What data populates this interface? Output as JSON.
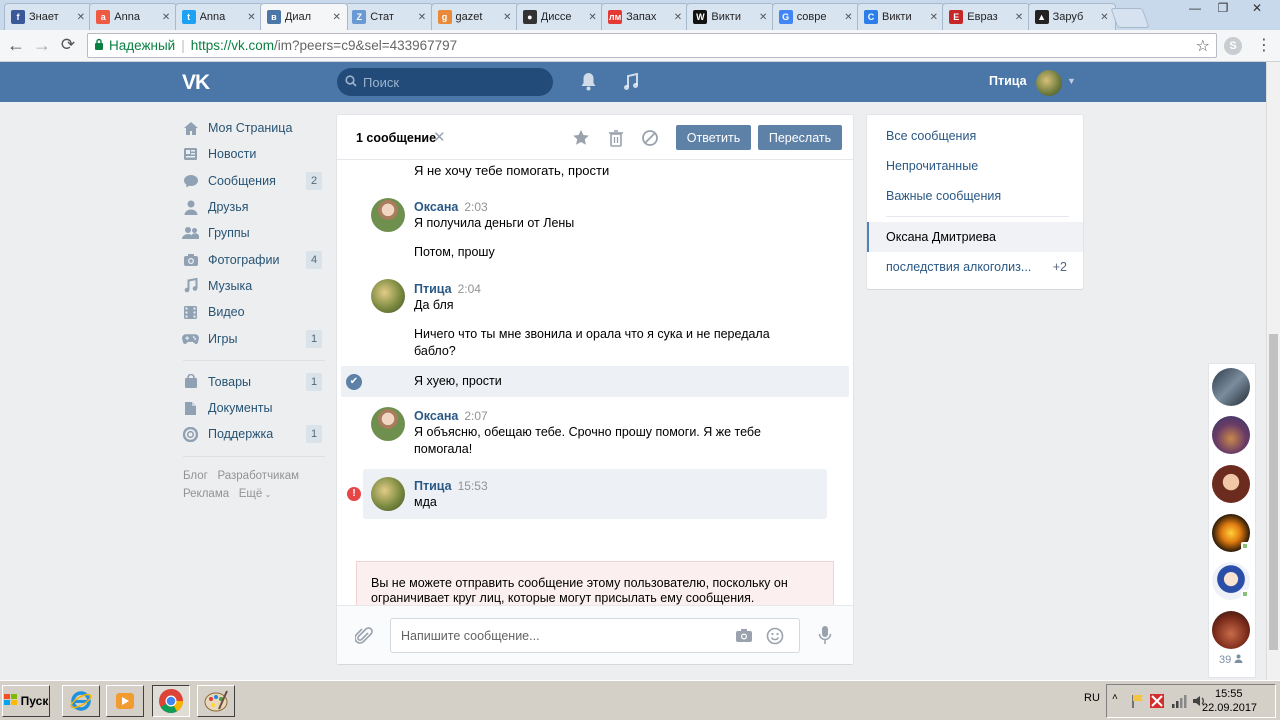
{
  "browser": {
    "tabs": [
      {
        "title": "Знает",
        "icon": "facebook-icon",
        "color": "#3b5998",
        "glyph": "f"
      },
      {
        "title": "Anna",
        "icon": "ask-icon",
        "color": "#ef5b42",
        "glyph": "a"
      },
      {
        "title": "Anna",
        "icon": "twitter-icon",
        "color": "#1da1f2",
        "glyph": "t"
      },
      {
        "title": "Диал",
        "icon": "vk-icon",
        "color": "#4a76a8",
        "glyph": "в",
        "active": true
      },
      {
        "title": "Стат",
        "icon": "z-icon",
        "color": "#6a9ad4",
        "glyph": "Z"
      },
      {
        "title": "gazet",
        "icon": "gazeta-icon",
        "color": "#e88a3a",
        "glyph": "g"
      },
      {
        "title": "Диссе",
        "icon": "soccer-icon",
        "color": "#333333",
        "glyph": "●"
      },
      {
        "title": "Запах",
        "icon": "lm-icon",
        "color": "#e53935",
        "glyph": "лм"
      },
      {
        "title": "Викти",
        "icon": "wiki-icon",
        "color": "#111111",
        "glyph": "W"
      },
      {
        "title": "совре",
        "icon": "google-icon",
        "color": "#4285f4",
        "glyph": "G"
      },
      {
        "title": "Викти",
        "icon": "c-icon",
        "color": "#2b7de9",
        "glyph": "C"
      },
      {
        "title": "Евраз",
        "icon": "e-icon",
        "color": "#c62828",
        "glyph": "E"
      },
      {
        "title": "Заруб",
        "icon": "grad-icon",
        "color": "#222222",
        "glyph": "▲"
      }
    ],
    "secure_label": "Надежный",
    "url_host": "https://vk.com",
    "url_path": "/im?peers=c9&sel=433967797"
  },
  "vk": {
    "search_placeholder": "Поиск",
    "user_name": "Птица",
    "menu": [
      {
        "label": "Моя Страница",
        "icon": "home-icon",
        "count": ""
      },
      {
        "label": "Новости",
        "icon": "news-icon",
        "count": ""
      },
      {
        "label": "Сообщения",
        "icon": "messages-icon",
        "count": "2"
      },
      {
        "label": "Друзья",
        "icon": "friends-icon",
        "count": ""
      },
      {
        "label": "Группы",
        "icon": "groups-icon",
        "count": ""
      },
      {
        "label": "Фотографии",
        "icon": "camera-icon",
        "count": "4"
      },
      {
        "label": "Музыка",
        "icon": "music-icon",
        "count": ""
      },
      {
        "label": "Видео",
        "icon": "video-icon",
        "count": ""
      },
      {
        "label": "Игры",
        "icon": "games-icon",
        "count": "1"
      }
    ],
    "menu2": [
      {
        "label": "Товары",
        "icon": "goods-icon",
        "count": "1"
      },
      {
        "label": "Документы",
        "icon": "documents-icon",
        "count": ""
      },
      {
        "label": "Поддержка",
        "icon": "support-icon",
        "count": "1"
      }
    ],
    "footer": [
      "Блог",
      "Разработчикам",
      "Реклама",
      "Ещё"
    ],
    "chat_header": {
      "selected": "1 сообщение",
      "reply": "Ответить",
      "forward": "Переслать"
    },
    "messages": [
      {
        "name": "",
        "time": "",
        "lines": [
          "Я не хочу тебе помогать, прости"
        ]
      },
      {
        "name": "Оксана",
        "time": "2:03",
        "lines": [
          "Я получила деньги от Лены"
        ]
      },
      {
        "name": "",
        "time": "",
        "lines": [
          "Потом, прошу"
        ]
      },
      {
        "name": "Птица",
        "time": "2:04",
        "lines": [
          "Да бля"
        ]
      },
      {
        "name": "",
        "time": "",
        "lines": [
          "Ничего что ты мне звонила и орала что я сука и не передала",
          "бабло?"
        ]
      },
      {
        "name": "",
        "time": "",
        "lines": [
          "Я хуею, прости"
        ],
        "selected": true
      },
      {
        "name": "Оксана",
        "time": "2:07",
        "lines": [
          "Я объясню, обещаю тебе. Срочно прошу помоги. Я же тебе",
          "помогала!"
        ]
      },
      {
        "name": "Птица",
        "time": "15:53",
        "lines": [
          "мда"
        ],
        "error": true
      }
    ],
    "warning": "Вы не можете отправить сообщение этому пользователю, поскольку он ограничивает круг лиц, которые могут присылать ему сообщения.",
    "composer_placeholder": "Напишите сообщение...",
    "right_menu": {
      "all": "Все сообщения",
      "unread": "Непрочитанные",
      "important": "Важные сообщения",
      "current": "Оксана Дмитриева",
      "chat": "последствия алкоголиз...",
      "chat_badge": "+2"
    },
    "friends_count": "39"
  },
  "taskbar": {
    "start": "Пуск",
    "lang": "RU",
    "time": "15:55",
    "date": "22.09.2017"
  }
}
